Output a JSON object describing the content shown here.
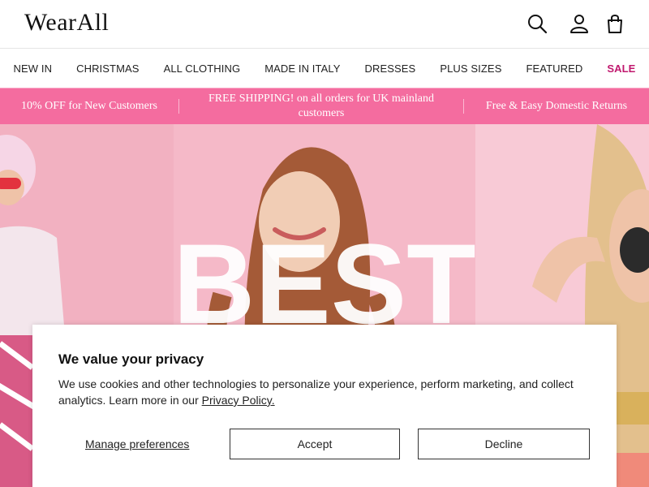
{
  "brand": {
    "logo_text": "WearAll"
  },
  "header": {
    "icons": [
      "search-icon",
      "account-icon",
      "bag-icon"
    ]
  },
  "nav": {
    "items": [
      "NEW IN",
      "CHRISTMAS",
      "ALL CLOTHING",
      "MADE IN ITALY",
      "DRESSES",
      "PLUS SIZES",
      "FEATURED",
      "SALE"
    ]
  },
  "promo": {
    "items": [
      "10% OFF for New Customers",
      "FREE SHIPPING! on all orders for UK mainland customers",
      "Free & Easy Domestic Returns"
    ]
  },
  "colors": {
    "promo_bg": "#f46c9f",
    "sale": "#c0186e",
    "hero_bg": "#f4b8c6"
  },
  "hero": {
    "banner_text": "BEST"
  },
  "cookie": {
    "title": "We value your privacy",
    "body": "We use cookies and other technologies to personalize your experience, perform marketing, and collect analytics. Learn more in our ",
    "link": "Privacy Policy.",
    "manage_label": "Manage preferences",
    "accept_label": "Accept",
    "decline_label": "Decline"
  }
}
